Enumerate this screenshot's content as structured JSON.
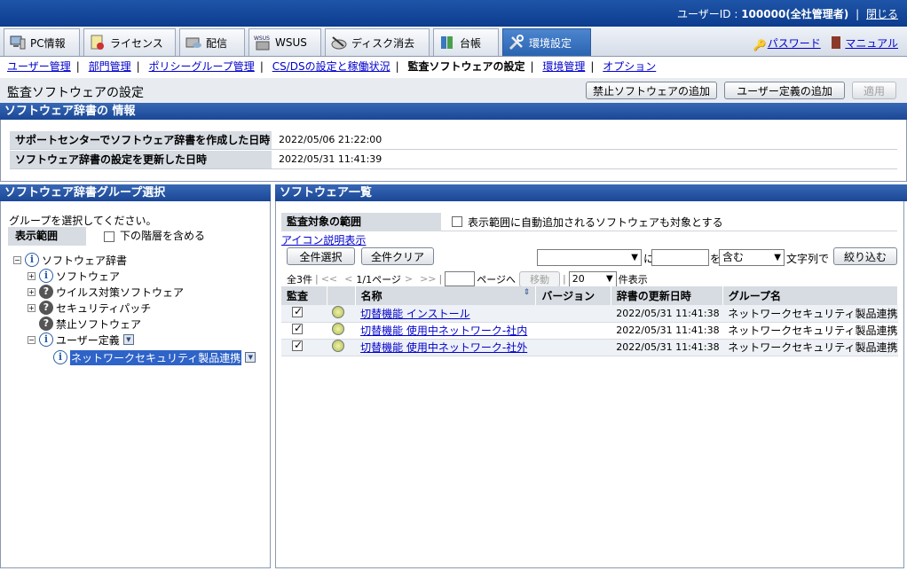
{
  "header": {
    "user_label": "ユーザーID : ",
    "user_value": "100000(全社管理者)",
    "sep": "|",
    "close_label": "閉じる"
  },
  "tabs": [
    {
      "label": "PC情報",
      "icon": "pc-icon"
    },
    {
      "label": "ライセンス",
      "icon": "license-icon"
    },
    {
      "label": "配信",
      "icon": "distribution-icon"
    },
    {
      "label": "WSUS",
      "icon": "wsus-icon"
    },
    {
      "label": "ディスク消去",
      "icon": "disk-erase-icon"
    },
    {
      "label": "台帳",
      "icon": "ledger-icon"
    },
    {
      "label": "環境設定",
      "icon": "tools-icon"
    }
  ],
  "right_links": {
    "password": "パスワード",
    "manual": "マニュアル"
  },
  "subnav": [
    {
      "label": "ユーザー管理"
    },
    {
      "label": "部門管理"
    },
    {
      "label": "ポリシーグループ管理"
    },
    {
      "label": "CS/DSの設定と稼働状況"
    },
    {
      "label": "監査ソフトウェアの設定"
    },
    {
      "label": "環境管理"
    },
    {
      "label": "オプション"
    }
  ],
  "page": {
    "title": "監査ソフトウェアの設定",
    "btn_add_forbidden": "禁止ソフトウェアの追加",
    "btn_add_user_def": "ユーザー定義の追加",
    "btn_apply": "適用"
  },
  "dict_info": {
    "title": "ソフトウェア辞書の 情報",
    "rows": [
      {
        "label": "サポートセンターでソフトウェア辞書を作成した日時",
        "value": "2022/05/06 21:22:00"
      },
      {
        "label": "ソフトウェア辞書の設定を更新した日時",
        "value": "2022/05/31 11:41:39"
      }
    ]
  },
  "group_panel": {
    "title": "ソフトウェア辞書グループ選択",
    "prompt": "グループを選択してください。",
    "scope_label": "表示範囲",
    "include_sub": "下の階層を含める",
    "tree": [
      {
        "label": "ソフトウェア辞書",
        "icon": "info",
        "level": 0,
        "toggle": "−"
      },
      {
        "label": "ソフトウェア",
        "icon": "info",
        "level": 1,
        "toggle": "+"
      },
      {
        "label": "ウイルス対策ソフトウェア",
        "icon": "question",
        "level": 1,
        "toggle": "+"
      },
      {
        "label": "セキュリティパッチ",
        "icon": "question",
        "level": 1,
        "toggle": "+"
      },
      {
        "label": "禁止ソフトウェア",
        "icon": "question",
        "level": 1,
        "toggle": ""
      },
      {
        "label": "ユーザー定義",
        "icon": "info",
        "level": 1,
        "toggle": "−",
        "menu": true
      },
      {
        "label": "ネットワークセキュリティ製品連携",
        "icon": "info",
        "level": 2,
        "toggle": "",
        "menu": true,
        "selected": true
      }
    ]
  },
  "software_panel": {
    "title": "ソフトウェア一覧",
    "scope_label": "監査対象の範囲",
    "auto_add_label": "表示範囲に自動追加されるソフトウェアも対象とする",
    "icon_legend": "アイコン説明表示",
    "select_all": "全件選択",
    "clear_all": "全件クリア",
    "filter": {
      "ni": "に",
      "wo": "を",
      "contains": "含む",
      "suffix": "文字列で",
      "btn": "絞り込む"
    },
    "paging": {
      "total": "全3件",
      "first": "<<",
      "prev": "<",
      "pages": "1/1ページ",
      "next": ">",
      "last": ">>",
      "goto_suffix": "ページへ",
      "move_btn": "移動",
      "per_page": "20",
      "per_page_suffix": "件表示"
    },
    "columns": [
      "監査",
      "",
      "名称",
      "バージョン",
      "辞書の更新日時",
      "グループ名"
    ],
    "rows": [
      {
        "checked": true,
        "name": "切替機能 インストール",
        "version": "",
        "updated": "2022/05/31 11:41:38",
        "group": "ネットワークセキュリティ製品連携"
      },
      {
        "checked": true,
        "name": "切替機能 使用中ネットワーク-社内",
        "version": "",
        "updated": "2022/05/31 11:41:38",
        "group": "ネットワークセキュリティ製品連携"
      },
      {
        "checked": true,
        "name": "切替機能 使用中ネットワーク-社外",
        "version": "",
        "updated": "2022/05/31 11:41:38",
        "group": "ネットワークセキュリティ製品連携"
      }
    ]
  }
}
